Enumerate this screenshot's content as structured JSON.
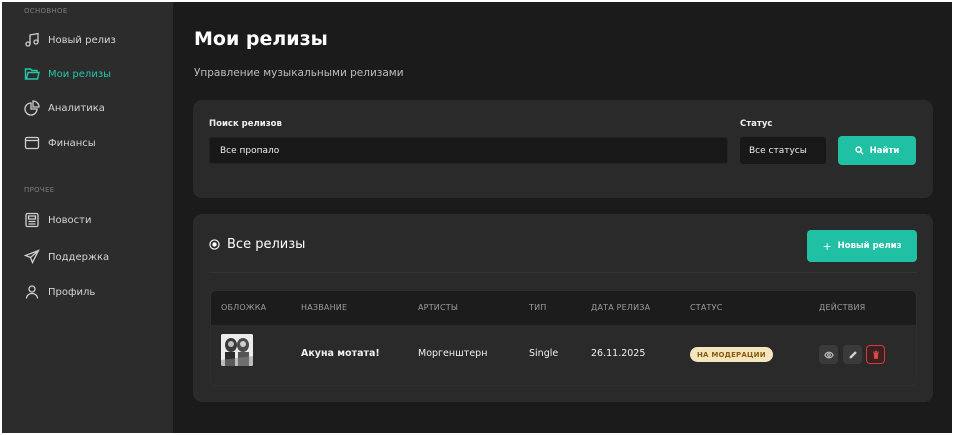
{
  "sidebar": {
    "section_main": "ОСНОВНОЕ",
    "section_other": "ПРОЧЕЕ",
    "items": [
      {
        "label": "Новый релиз",
        "icon": "music-note-icon"
      },
      {
        "label": "Мои релизы",
        "icon": "folder-icon",
        "active": true
      },
      {
        "label": "Аналитика",
        "icon": "pie-chart-icon"
      },
      {
        "label": "Финансы",
        "icon": "wallet-icon"
      },
      {
        "label": "Новости",
        "icon": "newspaper-icon"
      },
      {
        "label": "Поддержка",
        "icon": "send-icon"
      },
      {
        "label": "Профиль",
        "icon": "user-icon"
      }
    ]
  },
  "header": {
    "title": "Мои релизы",
    "subtitle": "Управление музыкальными релизами"
  },
  "search": {
    "label": "Поиск релизов",
    "value": "Все пропало",
    "status_label": "Статус",
    "status_value": "Все статусы",
    "button_label": "Найти"
  },
  "releases": {
    "title": "Все релизы",
    "new_button_plus": "+",
    "new_button_label": "Новый релиз",
    "columns": [
      "ОБЛОЖКА",
      "НАЗВАНИЕ",
      "АРТИСТЫ",
      "ТИП",
      "ДАТА РЕЛИЗА",
      "СТАТУС",
      "ДЕЙСТВИЯ"
    ],
    "rows": [
      {
        "title": "Акуна мотата!",
        "artists": "Моргенштерн",
        "type": "Single",
        "date": "26.11.2025",
        "status": "НА МОДЕРАЦИИ"
      }
    ]
  },
  "colors": {
    "accent": "#1fc0a3",
    "sidebar_bg": "#2c2c2c",
    "main_bg": "#1b1b1b",
    "card_bg": "#2a2a2a",
    "status_badge_bg": "#f4e5bd",
    "danger": "#d63a3a"
  }
}
